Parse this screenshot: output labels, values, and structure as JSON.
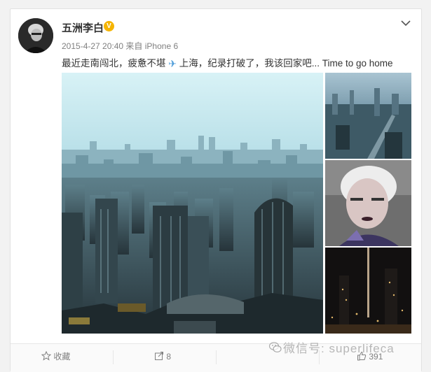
{
  "post": {
    "author": "五洲李白",
    "verified_badge": "V",
    "time": "2015-4-27 20:40",
    "source": "来自 iPhone 6",
    "text_before": "最近走南闯北，疲惫不堪",
    "plane_icon": "✈",
    "text_after": "上海，纪录打破了，我该回家吧... Time to go home"
  },
  "footer": {
    "favorite_label": "收藏",
    "repost_count": "8",
    "like_count": "391"
  },
  "watermark": {
    "text": "微信号: superlifeca"
  },
  "icons": [
    "avatar",
    "verified-badge",
    "chevron-down-icon",
    "plane-icon",
    "star-icon",
    "repost-icon",
    "like-icon",
    "wechat-icon"
  ],
  "colors": {
    "badge": "#f5b400",
    "plane": "#4a9ad8",
    "text": "#333333",
    "meta": "#808080"
  }
}
